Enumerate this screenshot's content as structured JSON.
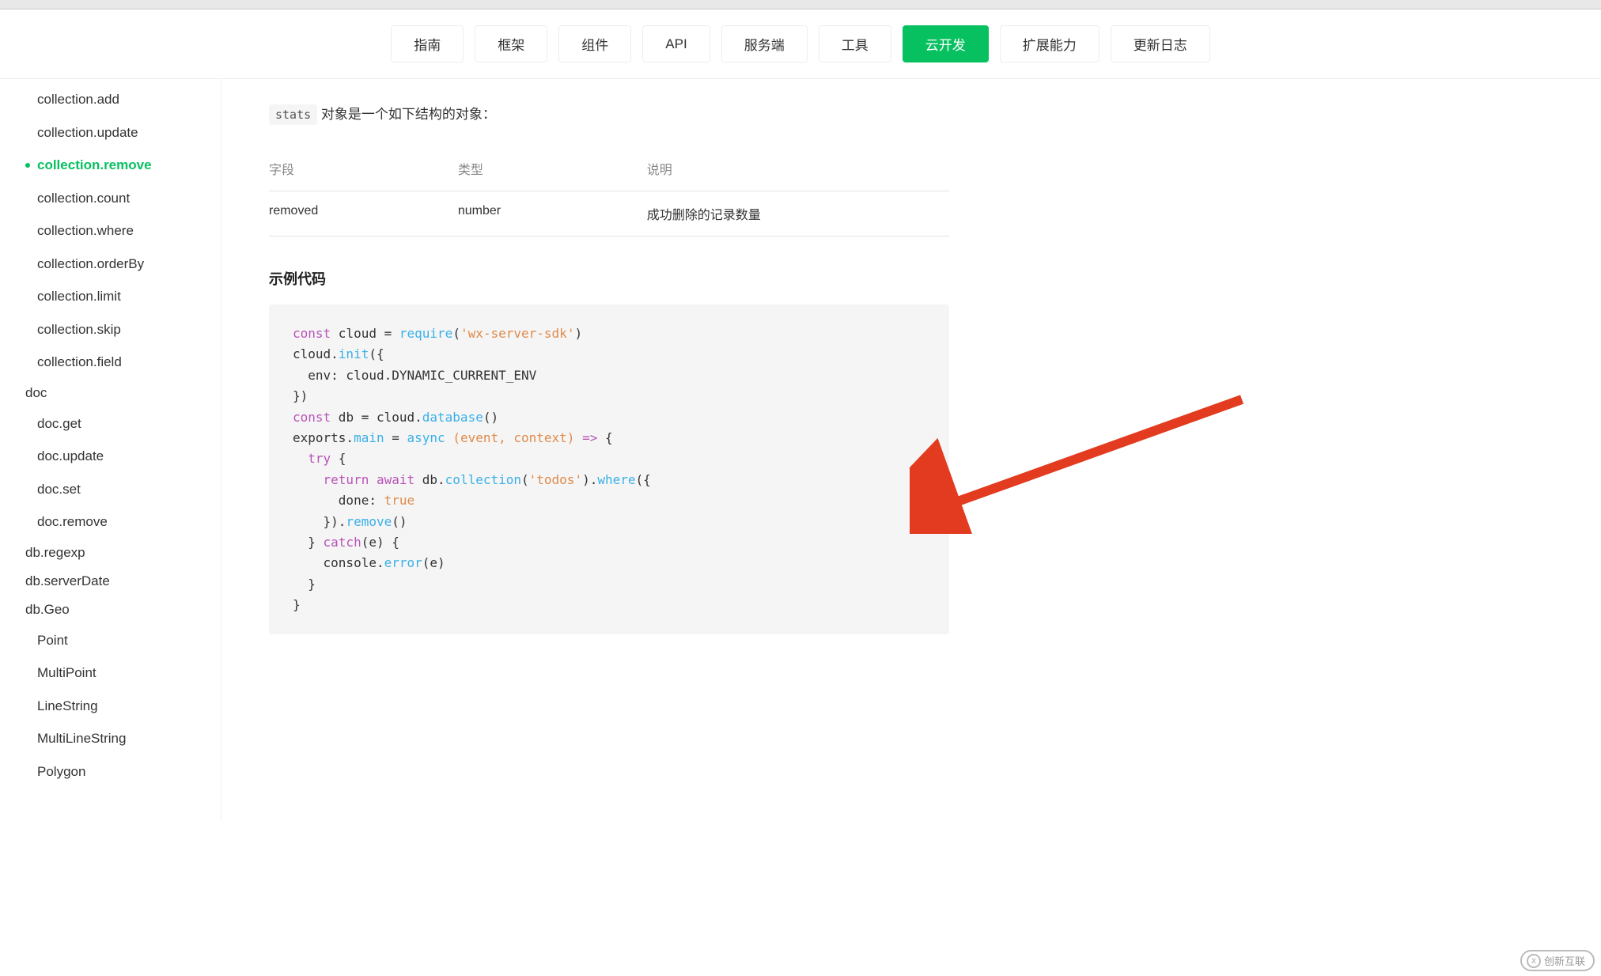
{
  "nav": {
    "items": [
      {
        "label": "指南",
        "active": false
      },
      {
        "label": "框架",
        "active": false
      },
      {
        "label": "组件",
        "active": false
      },
      {
        "label": "API",
        "active": false
      },
      {
        "label": "服务端",
        "active": false
      },
      {
        "label": "工具",
        "active": false
      },
      {
        "label": "云开发",
        "active": true
      },
      {
        "label": "扩展能力",
        "active": false
      },
      {
        "label": "更新日志",
        "active": false
      }
    ]
  },
  "sidebar": {
    "collection": [
      {
        "label": "collection.add",
        "active": false
      },
      {
        "label": "collection.update",
        "active": false
      },
      {
        "label": "collection.remove",
        "active": true
      },
      {
        "label": "collection.count",
        "active": false
      },
      {
        "label": "collection.where",
        "active": false
      },
      {
        "label": "collection.orderBy",
        "active": false
      },
      {
        "label": "collection.limit",
        "active": false
      },
      {
        "label": "collection.skip",
        "active": false
      },
      {
        "label": "collection.field",
        "active": false
      }
    ],
    "doc_label": "doc",
    "doc": [
      {
        "label": "doc.get"
      },
      {
        "label": "doc.update"
      },
      {
        "label": "doc.set"
      },
      {
        "label": "doc.remove"
      }
    ],
    "flat": [
      {
        "label": "db.regexp"
      },
      {
        "label": "db.serverDate"
      },
      {
        "label": "db.Geo"
      }
    ],
    "geo": [
      {
        "label": "Point"
      },
      {
        "label": "MultiPoint"
      },
      {
        "label": "LineString"
      },
      {
        "label": "MultiLineString"
      },
      {
        "label": "Polygon"
      }
    ]
  },
  "main": {
    "stats_pill": "stats",
    "stats_desc": " 对象是一个如下结构的对象：",
    "table": {
      "headers": [
        "字段",
        "类型",
        "说明"
      ],
      "rows": [
        [
          "removed",
          "number",
          "成功删除的记录数量"
        ]
      ]
    },
    "section_title": "示例代码",
    "code": {
      "tokens": [
        {
          "t": "kw",
          "v": "const"
        },
        {
          "t": "",
          "v": " cloud = "
        },
        {
          "t": "fn",
          "v": "require"
        },
        {
          "t": "",
          "v": "("
        },
        {
          "t": "str",
          "v": "'wx-server-sdk'"
        },
        {
          "t": "",
          "v": ")\n"
        },
        {
          "t": "",
          "v": "cloud."
        },
        {
          "t": "fn",
          "v": "init"
        },
        {
          "t": "",
          "v": "({\n"
        },
        {
          "t": "",
          "v": "  env: cloud.DYNAMIC_CURRENT_ENV\n"
        },
        {
          "t": "",
          "v": "})\n"
        },
        {
          "t": "kw",
          "v": "const"
        },
        {
          "t": "",
          "v": " db = cloud."
        },
        {
          "t": "fn",
          "v": "database"
        },
        {
          "t": "",
          "v": "()\n"
        },
        {
          "t": "",
          "v": "exports."
        },
        {
          "t": "fn",
          "v": "main"
        },
        {
          "t": "",
          "v": " = "
        },
        {
          "t": "asy",
          "v": "async"
        },
        {
          "t": "",
          "v": " "
        },
        {
          "t": "lt",
          "v": "(event, context)"
        },
        {
          "t": "",
          "v": " "
        },
        {
          "t": "kw",
          "v": "=>"
        },
        {
          "t": "",
          "v": " {\n"
        },
        {
          "t": "",
          "v": "  "
        },
        {
          "t": "kw",
          "v": "try"
        },
        {
          "t": "",
          "v": " {\n"
        },
        {
          "t": "",
          "v": "    "
        },
        {
          "t": "kw",
          "v": "return"
        },
        {
          "t": "",
          "v": " "
        },
        {
          "t": "kw",
          "v": "await"
        },
        {
          "t": "",
          "v": " db."
        },
        {
          "t": "fn",
          "v": "collection"
        },
        {
          "t": "",
          "v": "("
        },
        {
          "t": "str",
          "v": "'todos'"
        },
        {
          "t": "",
          "v": ")."
        },
        {
          "t": "fn",
          "v": "where"
        },
        {
          "t": "",
          "v": "({\n"
        },
        {
          "t": "",
          "v": "      done: "
        },
        {
          "t": "lt",
          "v": "true"
        },
        {
          "t": "",
          "v": "\n"
        },
        {
          "t": "",
          "v": "    })."
        },
        {
          "t": "fn",
          "v": "remove"
        },
        {
          "t": "",
          "v": "()\n"
        },
        {
          "t": "",
          "v": "  } "
        },
        {
          "t": "kw",
          "v": "catch"
        },
        {
          "t": "",
          "v": "(e) {\n"
        },
        {
          "t": "",
          "v": "    console."
        },
        {
          "t": "fn",
          "v": "error"
        },
        {
          "t": "",
          "v": "(e)\n"
        },
        {
          "t": "",
          "v": "  }\n"
        },
        {
          "t": "",
          "v": "}"
        }
      ]
    }
  },
  "watermark": {
    "symbol": "X",
    "text": "创新互联"
  }
}
